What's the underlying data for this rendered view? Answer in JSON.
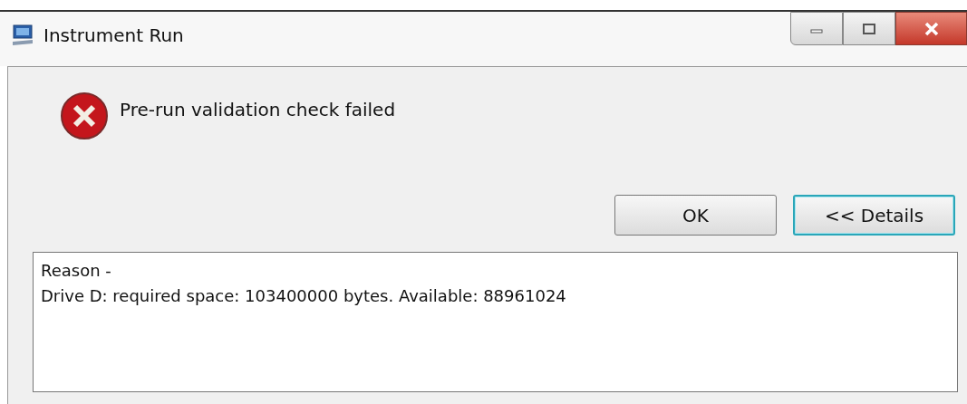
{
  "window": {
    "title": "Instrument Run"
  },
  "message": "Pre-run validation check failed",
  "buttons": [
    {
      "label": "OK",
      "kind": "plain"
    },
    {
      "label": "<< Details",
      "kind": "focused"
    }
  ],
  "details": {
    "lines": [
      "Reason -",
      "Drive D: required space: 103400000 bytes. Available: 88961024"
    ]
  }
}
